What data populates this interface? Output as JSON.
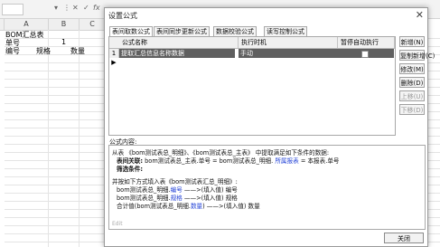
{
  "spreadsheet": {
    "columns": [
      "A",
      "B",
      "C"
    ],
    "cells": {
      "a1": "BOM汇总表",
      "a2": "单号",
      "b2": "1",
      "a3": "编号",
      "b3": "规格",
      "c3": "数量"
    }
  },
  "dialog": {
    "title": "设置公式",
    "close_glyph": "✕",
    "tabs": [
      "表间取数公式",
      "表间同步更新公式",
      "数据校验公式",
      "读写控制公式"
    ],
    "grid": {
      "headers": [
        "公式名称",
        "执行时机",
        "暂停自动执行"
      ],
      "rows": [
        {
          "indicator": "1 ▶",
          "name": "提取汇总信息名称数据",
          "timing": "手动",
          "paused": false
        }
      ]
    },
    "side_buttons": {
      "new": "新增(N)",
      "copy_new": "复制新增(C)",
      "modify": "修改(M)",
      "delete": "删除(D)",
      "up": "上移(U)",
      "down": "下移(D)"
    },
    "formula_label": "公式内容:",
    "formula": {
      "l1_a": "从表 《bom测试表总_明细》、《bom测试表总_主表》 中提取满足如下条件的数据:",
      "l2_a": "表间关联:",
      "l2_b": "bom测试表总_主表.单号 = bom测试表总_明细.",
      "l2_c": "所属报表",
      "l2_d": "= 本报表.单号",
      "l3": "筛选条件:",
      "l4": "并按如下方式填入表《bom测试表汇总_明细》:",
      "l5_a": "bom测试表总_明细.",
      "l5_b": "编号",
      "l5_c": "——>(填入值) 编号",
      "l6_a": "bom测试表总_明细.",
      "l6_b": "规格",
      "l6_c": "——>(填入值) 规格",
      "l7_a": "合计值(bom测试表总_明细.",
      "l7_b": "数量",
      "l7_c": ") ——>(填入值) 数量",
      "footer": "Edit"
    },
    "close_button": "关闭"
  }
}
